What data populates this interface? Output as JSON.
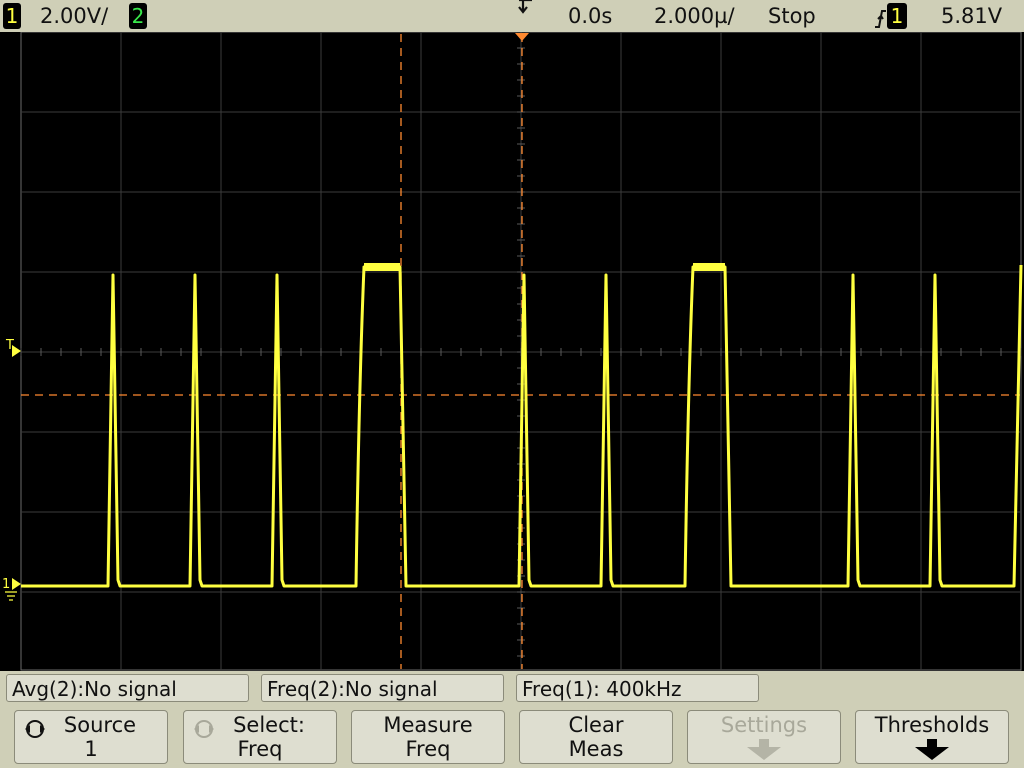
{
  "status_bar": {
    "ch1_number": "1",
    "ch1_scale": "2.00V/",
    "ch2_number": "2",
    "time_delay": "0.0s",
    "time_scale": "2.000µ/",
    "run_state": "Stop",
    "trigger_edge_icon": "rising-edge-icon",
    "trigger_source": "1",
    "trigger_level": "5.81V"
  },
  "colors": {
    "ch1": "#ffff40",
    "ch2": "#39e84a",
    "cursor": "#ff8a30",
    "bar": "#cfcfb7"
  },
  "markers": {
    "trigger_level_marker": "T",
    "ch1_ground_marker": "1"
  },
  "measurements": [
    {
      "label": "Avg(2):No signal"
    },
    {
      "label": "Freq(2):No signal"
    },
    {
      "label": "Freq(1): 400kHz"
    }
  ],
  "softkeys": {
    "source": {
      "line1": "Source",
      "line2": "1",
      "icon": "entry-knob-icon"
    },
    "select": {
      "line1": "Select:",
      "line2": "Freq",
      "icon": "entry-knob-icon"
    },
    "measure": {
      "line1": "Measure",
      "line2": "Freq"
    },
    "clear": {
      "line1": "Clear",
      "line2": "Meas"
    },
    "settings": {
      "line1": "Settings",
      "icon": "down-arrow-icon"
    },
    "thresholds": {
      "line1": "Thresholds",
      "icon": "down-arrow-icon"
    }
  }
}
